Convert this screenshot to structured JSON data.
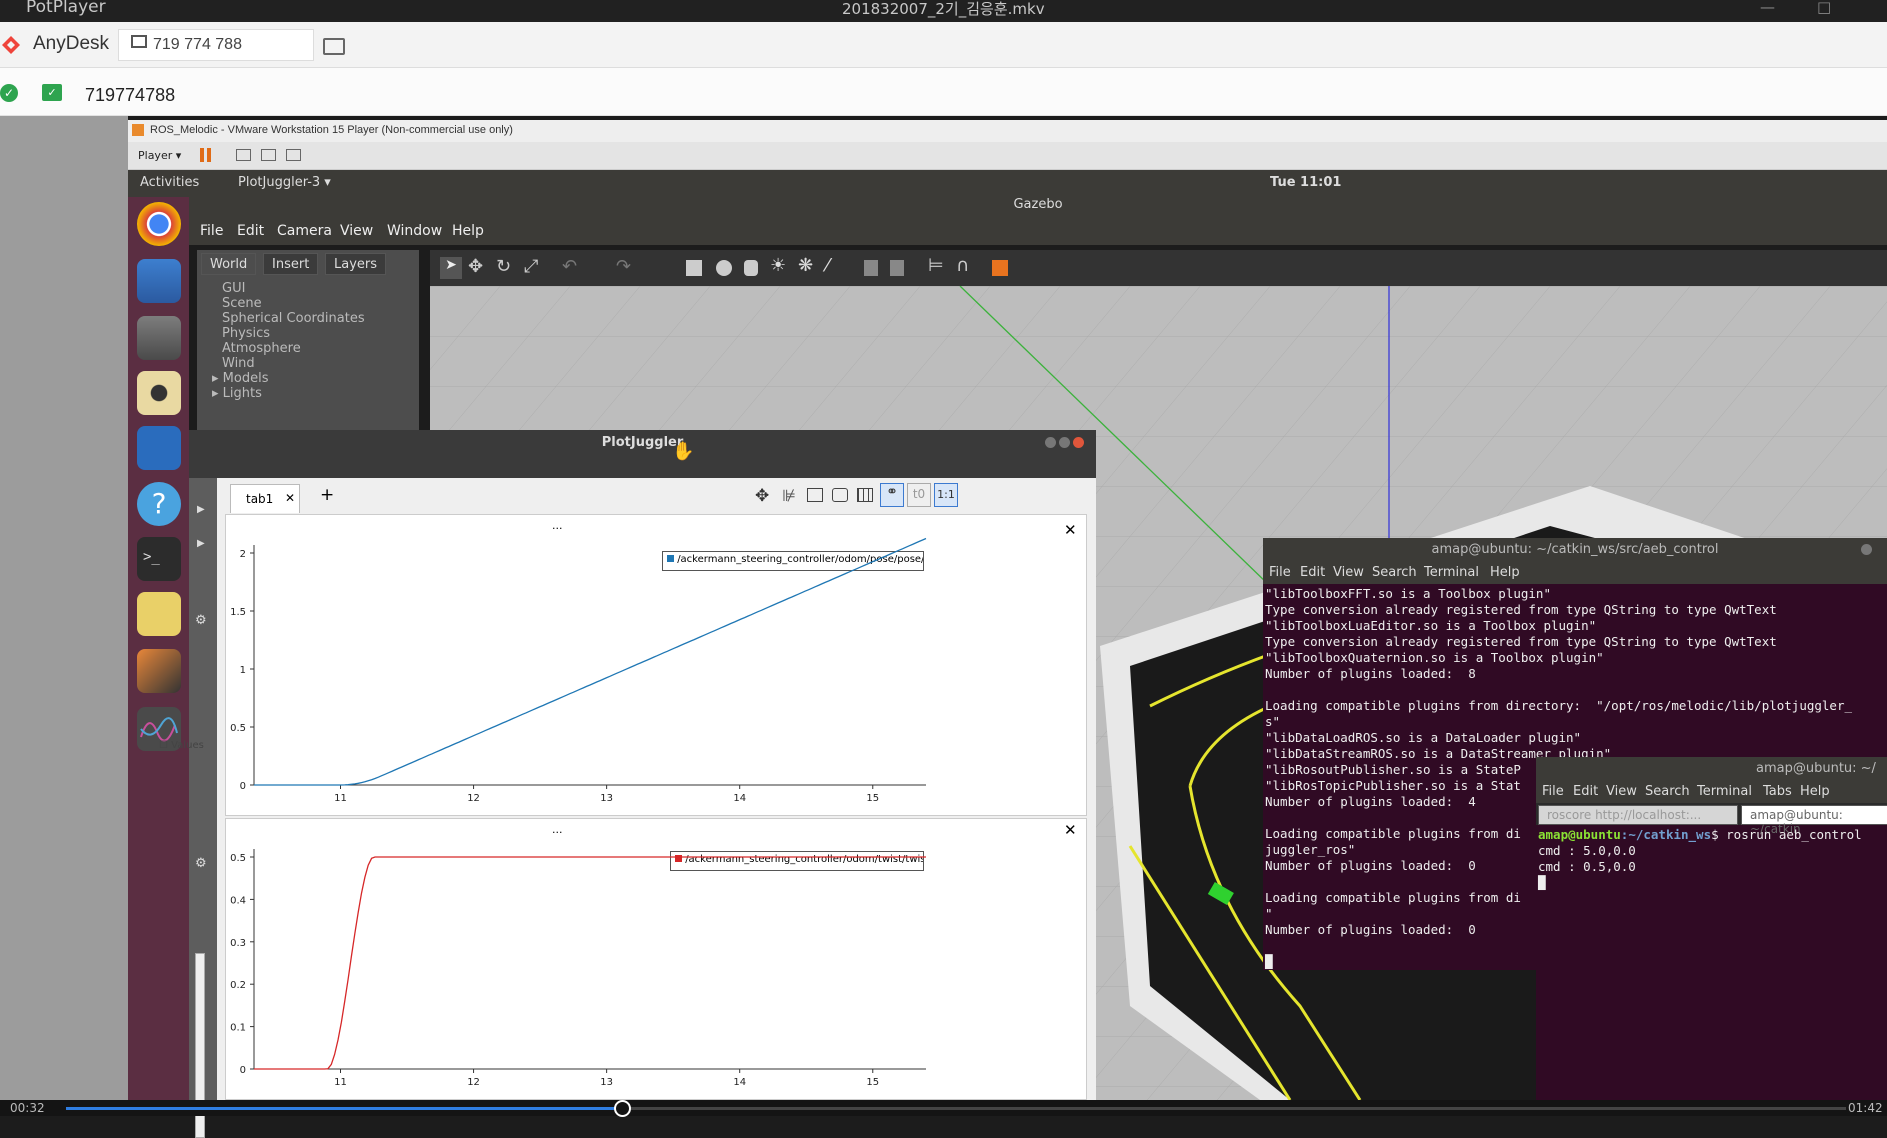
{
  "potplayer": {
    "app_name": "PotPlayer",
    "file_title": "201832007_2기_김응훈.mkv",
    "time_elapsed": "00:32",
    "time_total": "01:42",
    "seek_progress": 0.313
  },
  "anydesk": {
    "app_name": "AnyDesk",
    "tab_label": "719 774 788",
    "remote_id": "719774788"
  },
  "vmware": {
    "title": "ROS_Melodic - VMware Workstation 15 Player (Non-commercial use only)",
    "player_menu": "Player"
  },
  "ubuntu": {
    "activities": "Activities",
    "active_app": "PlotJuggler-3",
    "clock": "Tue 11:01"
  },
  "gazebo": {
    "title": "Gazebo",
    "menu": [
      "File",
      "Edit",
      "Camera",
      "View",
      "Window",
      "Help"
    ],
    "tabs": [
      "World",
      "Insert",
      "Layers"
    ],
    "tree": [
      "GUI",
      "Scene",
      "Spherical Coordinates",
      "Physics",
      "Atmosphere",
      "Wind",
      "Models",
      "Lights"
    ]
  },
  "plotjuggler": {
    "title": "PlotJuggler",
    "tab_label": "tab1",
    "add_tab": "+",
    "plot_dots": "...",
    "values_label": "Values",
    "ratio_button": "1:1",
    "plots": [
      {
        "legend": "/ackermann_steering_controller/odom/pose/pose/position/x",
        "color": "#1f77b4",
        "y_ticks": [
          "2",
          "1.5",
          "1",
          "0.5",
          "0"
        ],
        "x_ticks": [
          "11",
          "12",
          "13",
          "14",
          "15"
        ]
      },
      {
        "legend": "/ackermann_steering_controller/odom/twist/twist/linear/x",
        "color": "#d62728",
        "y_ticks": [
          "0.5",
          "0.4",
          "0.3",
          "0.2",
          "0.1",
          "0"
        ],
        "x_ticks": [
          "11",
          "12",
          "13",
          "14",
          "15"
        ]
      }
    ]
  },
  "terminal1": {
    "title": "amap@ubuntu: ~/catkin_ws/src/aeb_control",
    "menu": [
      "File",
      "Edit",
      "View",
      "Search",
      "Terminal",
      "Help"
    ],
    "lines": [
      "\"libToolboxFFT.so is a Toolbox plugin\"",
      "Type conversion already registered from type QString to type QwtText",
      "\"libToolboxLuaEditor.so is a Toolbox plugin\"",
      "Type conversion already registered from type QString to type QwtText",
      "\"libToolboxQuaternion.so is a Toolbox plugin\"",
      "Number of plugins loaded:  8",
      "",
      "Loading compatible plugins from directory:  \"/opt/ros/melodic/lib/plotjuggler_",
      "s\"",
      "\"libDataLoadROS.so is a DataLoader plugin\"",
      "\"libDataStreamROS.so is a DataStreamer plugin\"",
      "\"libRosoutPublisher.so is a StateP",
      "\"libRosTopicPublisher.so is a Stat",
      "Number of plugins loaded:  4",
      "",
      "Loading compatible plugins from di",
      "juggler_ros\"",
      "Number of plugins loaded:  0",
      "",
      "Loading compatible plugins from di",
      "\"",
      "Number of plugins loaded:  0",
      "",
      "█"
    ]
  },
  "terminal2": {
    "title": "amap@ubuntu: ~/",
    "menu": [
      "File",
      "Edit",
      "View",
      "Search",
      "Terminal",
      "Tabs",
      "Help"
    ],
    "tabs": [
      "roscore http://localhost:...",
      "amap@ubuntu: ~/catkin"
    ],
    "prompt_user": "amap@ubuntu",
    "prompt_path": ":~/catkin_ws",
    "command": "$ rosrun aeb_control",
    "lines": [
      "cmd : 5.0,0.0",
      "cmd : 0.5,0.0",
      "█"
    ]
  }
}
